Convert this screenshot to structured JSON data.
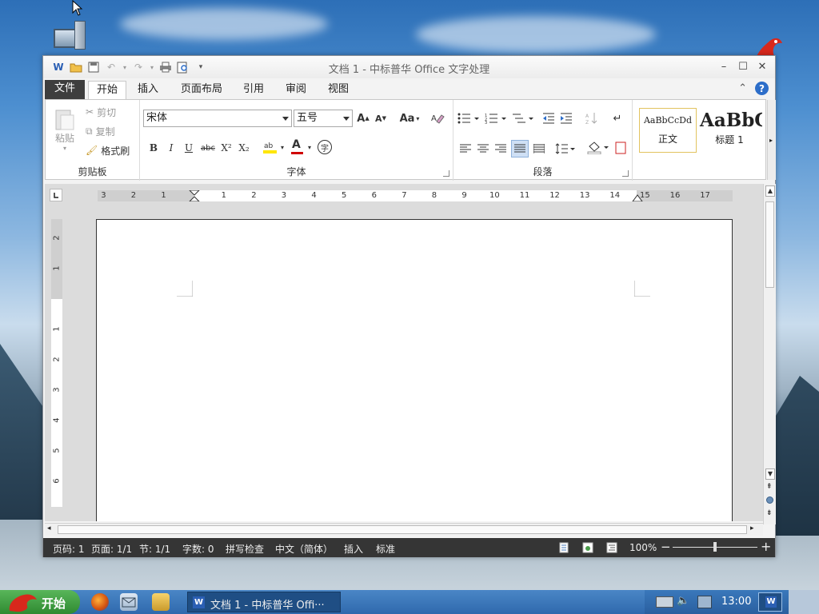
{
  "window": {
    "title": "文档 1 - 中标普华 Office 文字处理",
    "app_icon": "W"
  },
  "tabs": [
    "文件",
    "开始",
    "插入",
    "页面布局",
    "引用",
    "审阅",
    "视图"
  ],
  "ribbon": {
    "clipboard": {
      "paste": "粘贴",
      "cut": "剪切",
      "copy": "复制",
      "format_painter": "格式刷",
      "label": "剪贴板"
    },
    "font": {
      "font_name": "宋体",
      "font_size": "五号",
      "change_case": "Aa",
      "bold": "B",
      "italic": "I",
      "underline": "U",
      "strike": "abc",
      "superscript": "X²",
      "subscript": "X₂",
      "font_color_glyph": "A",
      "phonetic": "字",
      "label": "字体"
    },
    "paragraph": {
      "label": "段落"
    },
    "styles": {
      "normal_preview": "AaBbCcDd",
      "normal": "正文",
      "heading_preview": "AaBbC",
      "heading1": "标题 1"
    }
  },
  "ruler": {
    "h_left": [
      "3",
      "2",
      "1"
    ],
    "h_right": [
      "1",
      "2",
      "3",
      "4",
      "5",
      "6",
      "7",
      "8",
      "9",
      "10",
      "11",
      "12",
      "13",
      "14",
      "15",
      "16",
      "17"
    ],
    "v_top": [
      "2",
      "1"
    ],
    "v_bottom": [
      "1",
      "2",
      "3",
      "4",
      "5",
      "6"
    ]
  },
  "statusbar": {
    "page_num": "页码: 1",
    "page_count": "页面: 1/1",
    "section": "节: 1/1",
    "word_count": "字数: 0",
    "spell_check": "拼写检查",
    "language": "中文（简体）",
    "insert_mode": "插入",
    "standard": "标准",
    "zoom": "100%",
    "zoom_out": "−",
    "zoom_in": "+",
    "zoom_level_fraction": 0.5
  },
  "taskbar": {
    "start": "开始",
    "task_item": "文档 1 - 中标普华  Offi···",
    "clock": "13:00"
  },
  "colors": {
    "file_tab": "#3e3e3e",
    "statusbar": "#353535",
    "taskbar": "#2f69ad",
    "start": "#3a9a3c",
    "help": "#2d6ec9",
    "highlight_yellow": "#ffe600",
    "font_color_red": "#d00000"
  }
}
